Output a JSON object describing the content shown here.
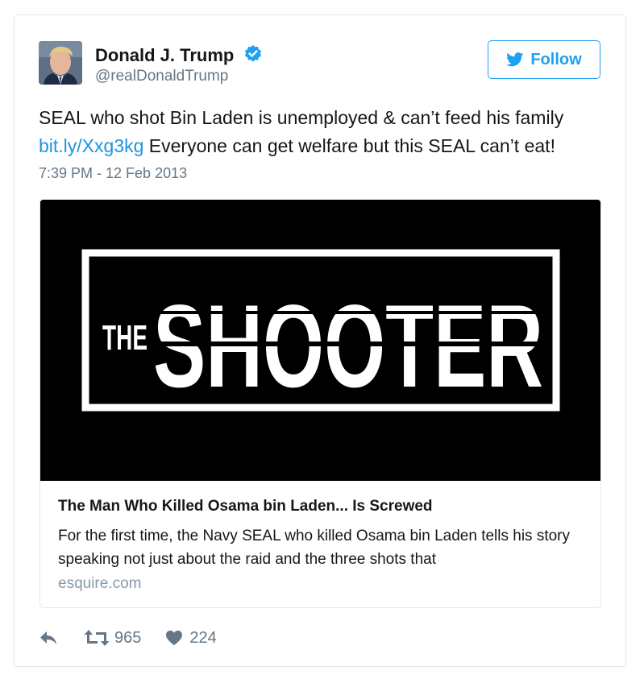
{
  "author": {
    "name": "Donald J. Trump",
    "handle": "@realDonaldTrump",
    "verified_icon": "verified-badge-icon"
  },
  "follow_button": {
    "label": "Follow",
    "icon": "twitter-bird-icon"
  },
  "tweet": {
    "text_line1": "SEAL who shot Bin Laden is unemployed & can’t feed his family",
    "link_text": "bit.ly/Xxg3kg",
    "text_line2": " Everyone can get welfare but this SEAL can’t eat!",
    "timestamp": "7:39 PM - 12 Feb 2013"
  },
  "card": {
    "image_word_small": "THE",
    "image_word_large": "SHOOTER",
    "title": "The Man Who Killed Osama bin Laden... Is Screwed",
    "description": "For the first time, the Navy SEAL who killed Osama bin Laden tells his story speaking not just about the raid and the three shots that",
    "domain": "esquire.com"
  },
  "actions": {
    "reply_icon": "reply-icon",
    "retweet_icon": "retweet-icon",
    "retweet_count": "965",
    "like_icon": "heart-icon",
    "like_count": "224"
  },
  "colors": {
    "link": "#1b95e0",
    "accent": "#1da1f2",
    "secondary_text": "#657786",
    "border": "#e1e8ed"
  }
}
